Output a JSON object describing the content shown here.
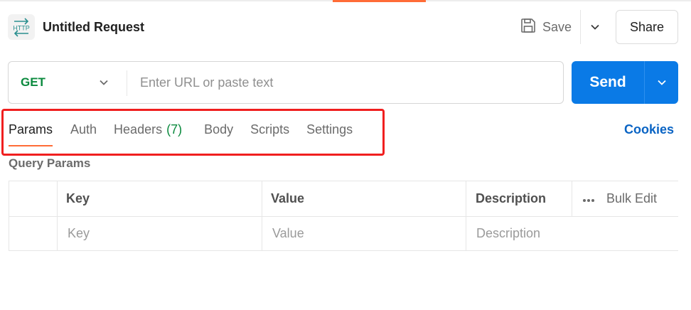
{
  "header": {
    "badge_text": "HTTP",
    "badge_icon": "http-arrows-icon",
    "title": "Untitled Request",
    "save_label": "Save",
    "share_label": "Share"
  },
  "request": {
    "method": "GET",
    "url_value": "",
    "url_placeholder": "Enter URL or paste text",
    "send_label": "Send"
  },
  "tabs": [
    {
      "label": "Params",
      "count": "",
      "active": true
    },
    {
      "label": "Auth",
      "count": "",
      "active": false
    },
    {
      "label": "Headers",
      "count": "(7)",
      "active": false
    },
    {
      "label": "Body",
      "count": "",
      "active": false
    },
    {
      "label": "Scripts",
      "count": "",
      "active": false
    },
    {
      "label": "Settings",
      "count": "",
      "active": false
    }
  ],
  "cookies_label": "Cookies",
  "query_params": {
    "title": "Query Params",
    "columns": {
      "key": "Key",
      "value": "Value",
      "description": "Description"
    },
    "bulk_edit_label": "Bulk Edit",
    "row_placeholders": {
      "key": "Key",
      "value": "Value",
      "description": "Description"
    }
  },
  "colors": {
    "accent": "#ff6c37",
    "send_blue": "#0a7ae6",
    "method_green": "#0b8a3e",
    "link_blue": "#0a64c4",
    "highlight_red": "#f01f1f"
  }
}
